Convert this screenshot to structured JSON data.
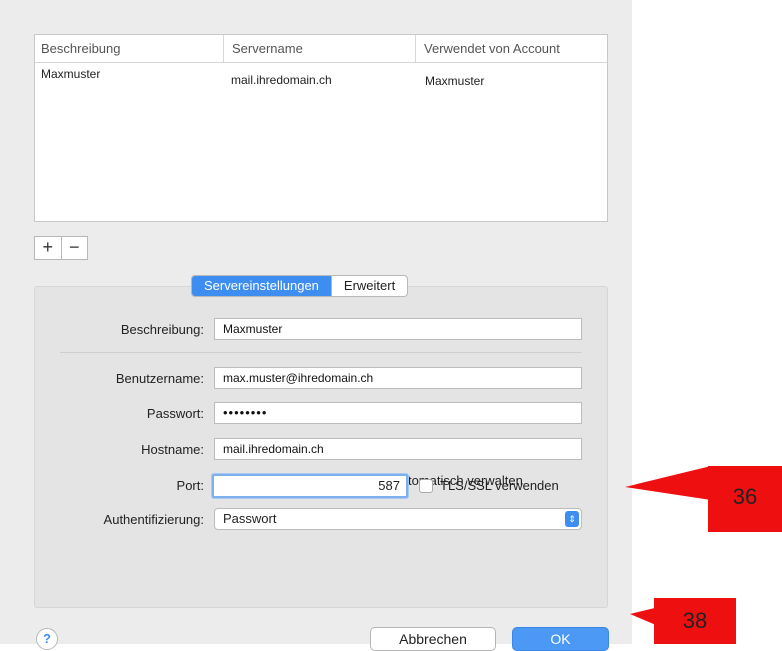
{
  "table": {
    "headers": [
      "Beschreibung",
      "Servername",
      "Verwendet von Account"
    ],
    "rows": [
      [
        "Maxmuster",
        "mail.ihredomain.ch",
        "Maxmuster"
      ]
    ]
  },
  "list_controls": {
    "add": "+",
    "remove": "−"
  },
  "tabs": {
    "server": "Servereinstellungen",
    "advanced": "Erweitert"
  },
  "form": {
    "description_label": "Beschreibung:",
    "description_value": "Maxmuster",
    "username_label": "Benutzername:",
    "username_value": "max.muster@ihredomain.ch",
    "password_label": "Passwort:",
    "password_value": "••••••••",
    "hostname_label": "Hostname:",
    "hostname_value": "mail.ihredomain.ch",
    "auto_manage_label": "Verbindungseinstellungen automatisch verwalten",
    "port_label": "Port:",
    "port_value": "587",
    "tls_label": "TLS/SSL verwenden",
    "auth_label": "Authentifizierung:",
    "auth_value": "Passwort"
  },
  "buttons": {
    "help": "?",
    "cancel": "Abbrechen",
    "ok": "OK"
  },
  "callouts": {
    "first": "36",
    "second": "38"
  },
  "colors": {
    "accent": "#3e8ef2",
    "callout": "#ee0f10"
  }
}
